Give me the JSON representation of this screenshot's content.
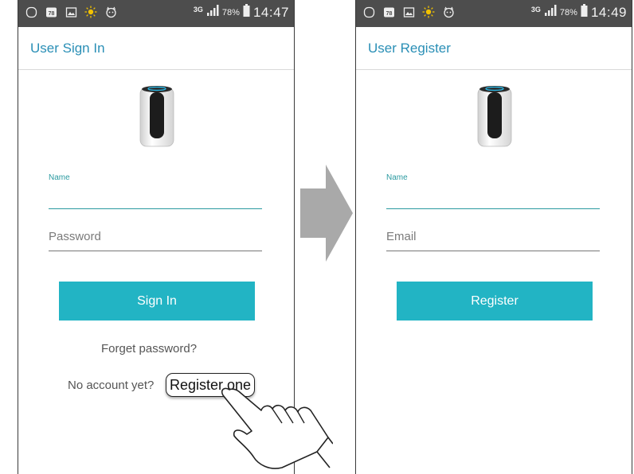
{
  "colors": {
    "accent": "#22b4c4",
    "title": "#2a8fb6",
    "status_bar": "#4d4d4d",
    "field_active": "#2a9aa0",
    "arrow": "#a9a9a9"
  },
  "status_bar_left": {
    "network": "3G",
    "battery": "78%",
    "time": "14:47",
    "icons": [
      "circle-outline-icon",
      "calendar-78-icon",
      "image-icon",
      "sun-icon",
      "cat-face-icon"
    ],
    "calendar_num": "78"
  },
  "status_bar_right": {
    "network": "3G",
    "battery": "78%",
    "time": "14:49",
    "calendar_num": "78"
  },
  "sign_in": {
    "title": "User Sign In",
    "name_label": "Name",
    "password_placeholder": "Password",
    "sign_in_button": "Sign In",
    "forget_password": "Forget password?",
    "no_account": "No account yet?",
    "register_link": "Register one"
  },
  "register": {
    "title": "User Register",
    "name_label": "Name",
    "email_placeholder": "Email",
    "register_button": "Register"
  }
}
